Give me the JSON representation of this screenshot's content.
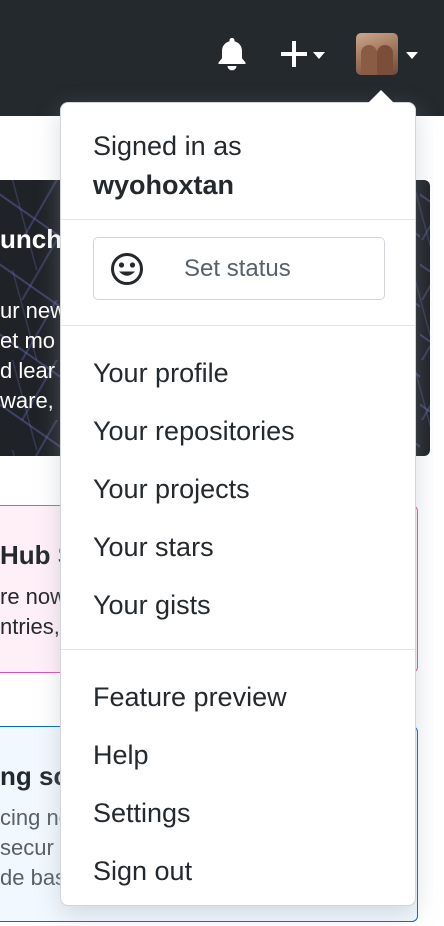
{
  "header": {
    "notifications_icon": "bell-icon",
    "create_icon": "plus-icon",
    "avatar_icon": "user-avatar"
  },
  "background": {
    "dark_card": {
      "title": "unch",
      "lines": [
        "ur new",
        "et mo",
        "d lear",
        "ware,"
      ]
    },
    "pink_card": {
      "title": "Hub S",
      "lines": [
        "re now",
        "ntries,"
      ]
    },
    "blue_card": {
      "title": "ng sc",
      "lines": [
        "cing ne",
        "secur",
        "de bas"
      ]
    }
  },
  "dropdown": {
    "signed_in_label": "Signed in as",
    "username": "wyohoxtan",
    "status_button": {
      "icon": "smiley-icon",
      "label": "Set status"
    },
    "group1": [
      "Your profile",
      "Your repositories",
      "Your projects",
      "Your stars",
      "Your gists"
    ],
    "group2": [
      "Feature preview",
      "Help",
      "Settings",
      "Sign out"
    ]
  },
  "colors": {
    "header_bg": "#24292e",
    "text": "#24292e",
    "muted": "#586069",
    "border": "#d1d5da",
    "pink_border": "#ea4aaa",
    "blue_border": "#0366d6"
  }
}
